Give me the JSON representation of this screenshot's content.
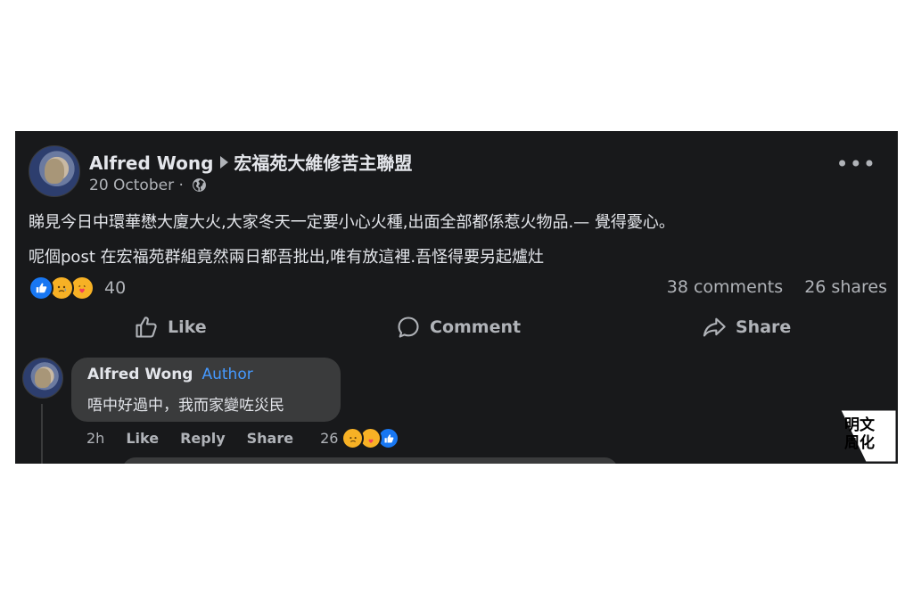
{
  "post": {
    "author": "Alfred Wong",
    "group": "宏福苑大維修苦主聯盟",
    "date": "20 October",
    "date_separator": "·",
    "privacy_icon": "globe-icon",
    "more_icon": "more-options-icon",
    "text_line_1": "睇見今日中環華懋大廈大火,大家冬天一定要小心火種,出面全部都係惹火物品.— 覺得憂心。",
    "text_line_2": "呢個post 在宏福苑群組竟然兩日都吾批出,唯有放這裡.吾怪得要另起爐灶",
    "reactions": {
      "icons": [
        "like-reaction-icon",
        "sad-reaction-icon",
        "care-reaction-icon"
      ],
      "count": "40"
    },
    "comments_count": "38 comments",
    "shares_count": "26 shares"
  },
  "actions": {
    "like_label": "Like",
    "comment_label": "Comment",
    "share_label": "Share"
  },
  "comment": {
    "author": "Alfred Wong",
    "badge": "Author",
    "text": "唔中好過中，我而家變咗災民",
    "time": "2h",
    "like_label": "Like",
    "reply_label": "Reply",
    "share_label": "Share",
    "reaction_count": "26",
    "reaction_icons": [
      "sad-reaction-icon",
      "care-reaction-icon",
      "like-reaction-icon"
    ]
  },
  "watermark": {
    "text": "明周文化"
  },
  "colors": {
    "card_background": "#18191b",
    "bubble_background": "#3a3b3c",
    "primary_text": "#e4e6eb",
    "secondary_text": "#b0b3b8",
    "author_badge": "#4599ff",
    "like_blue": "#1877f2",
    "emoji_yellow": "#f7b125"
  }
}
